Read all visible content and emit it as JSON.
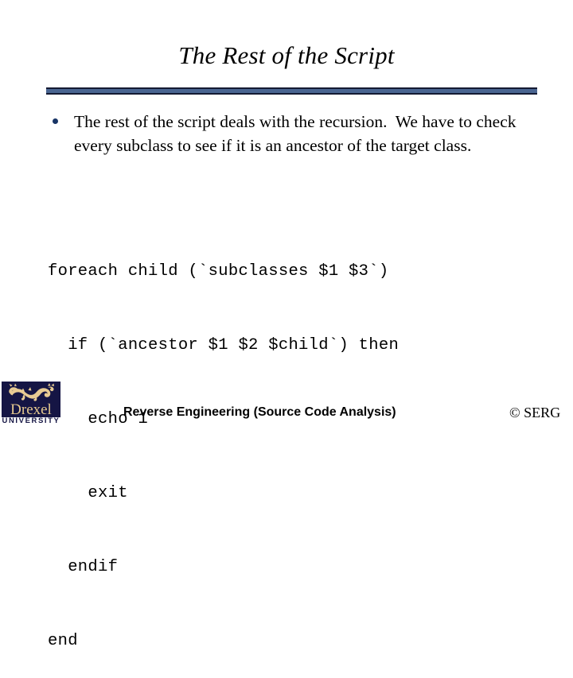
{
  "slide": {
    "title": "The Rest of the Script",
    "background_color": "#ffffff",
    "rule_fill_color": "#4a6591",
    "rule_border_color": "#141a33",
    "bullet_color": "#183465"
  },
  "body": {
    "bullets": [
      {
        "text": "The rest of the script deals with the recursion.  We have to check every subclass to see if it is an ancestor of the target class.",
        "marker": "bullet-dot"
      }
    ]
  },
  "code": {
    "language": "shell-script",
    "lines": [
      "foreach child (`subclasses $1 $3`)",
      "  if (`ancestor $1 $2 $child`) then",
      "    echo 1",
      "    exit",
      "  endif",
      "end"
    ]
  },
  "logo": {
    "name": "drexel-university-logo",
    "wordmark": "Drexel",
    "subtext": "UNIVERSITY",
    "box_color": "#151544",
    "gold_color": "#e6c98f"
  },
  "footer": {
    "center_label": "Reverse Engineering (Source Code Analysis)",
    "right_label": "© SERG"
  }
}
